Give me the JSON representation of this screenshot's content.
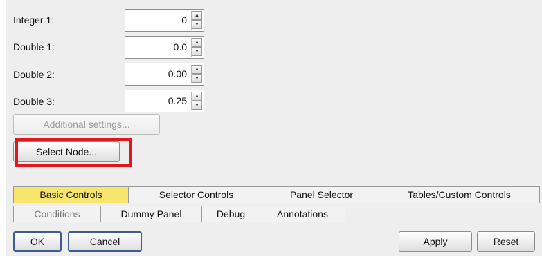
{
  "form": {
    "fields": [
      {
        "label": "Integer 1:",
        "value": "0"
      },
      {
        "label": "Double 1:",
        "value": "0.0"
      },
      {
        "label": "Double 2:",
        "value": "0.00"
      },
      {
        "label": "Double 3:",
        "value": "0.25"
      }
    ],
    "additional_settings_label": "Additional settings...",
    "select_node_label": "Select Node..."
  },
  "tabs": {
    "row1": [
      "Basic Controls",
      "Selector Controls",
      "Panel Selector",
      "Tables/Custom Controls"
    ],
    "row2": [
      "Conditions",
      "Dummy Panel",
      "Debug",
      "Annotations"
    ],
    "selected": "Basic Controls"
  },
  "footer": {
    "ok_label": "OK",
    "cancel_label": "Cancel",
    "apply_label": "Apply",
    "reset_label": "Reset"
  },
  "colors": {
    "selected_tab": "#f7e66b",
    "highlight_border": "#e2171b"
  }
}
